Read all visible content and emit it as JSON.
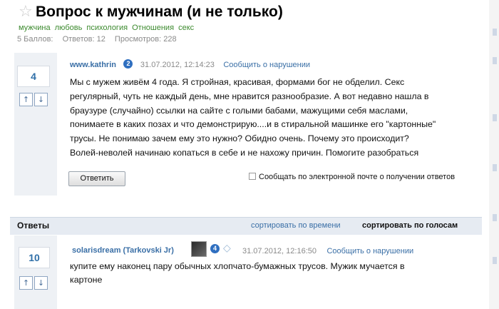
{
  "question": {
    "title": "Вопрос к мужчинам (и не только)",
    "tags": [
      "мужчина",
      "любовь",
      "психология",
      "Отношения",
      "секс"
    ],
    "meta": {
      "points": "5 Баллов:",
      "answers": "Ответов: 12",
      "views": "Просмотров: 228"
    },
    "score": "4",
    "author": "www.kathrin",
    "author_level": "2",
    "date": "31.07.2012, 12:14:23",
    "report_label": "Сообщить о нарушении",
    "text_lines": [
      "Мы с мужем живём 4 года. Я стройная, красивая, формами бог не обделил. Секс",
      "регулярный, чуть не каждый день, мне нравится разнообразие. А вот недавно нашла в",
      "браузуре (случайно) ссылки на сайте с голыми бабами, мажущими себя маслами,",
      "понимаете в каких позах и что демонстрирую....и в стиральной машинке его \"картонные\"",
      "трусы. Не понимаю зачем ему это нужно? Обидно очень. Почему это происходит?",
      "Волей-неволей начинаю копаться в себе и не нахожу причин. Помогите разобраться"
    ],
    "reply_label": "Ответить",
    "notify_label": "Сообщать по электронной почте о получении ответов"
  },
  "answers_section": {
    "title": "Ответы",
    "sort_by_time": "сортировать по времени",
    "sort_by_votes": "сортировать по голосам"
  },
  "answer": {
    "score": "10",
    "author": "solarisdream (Tarkovski Jr)",
    "author_level": "4",
    "date": "31.07.2012, 12:16:50",
    "report_label": "Сообщить о нарушении",
    "text_lines": [
      "купите ему наконец пару обычных хлопчато-бумажных трусов. Мужик мучается в",
      "картоне"
    ]
  },
  "icons": {
    "favorite": "star-icon",
    "vote_up": "arrow-up-icon",
    "vote_down": "arrow-down-icon",
    "level_badge": "level-badge-icon",
    "rank": "diamond-icon"
  },
  "colors": {
    "link": "#3a6fa6",
    "tag": "#3c8a2e",
    "score": "#2f6fa8",
    "badge": "#2f6fc0",
    "header_bg": "#e6ebf2"
  }
}
